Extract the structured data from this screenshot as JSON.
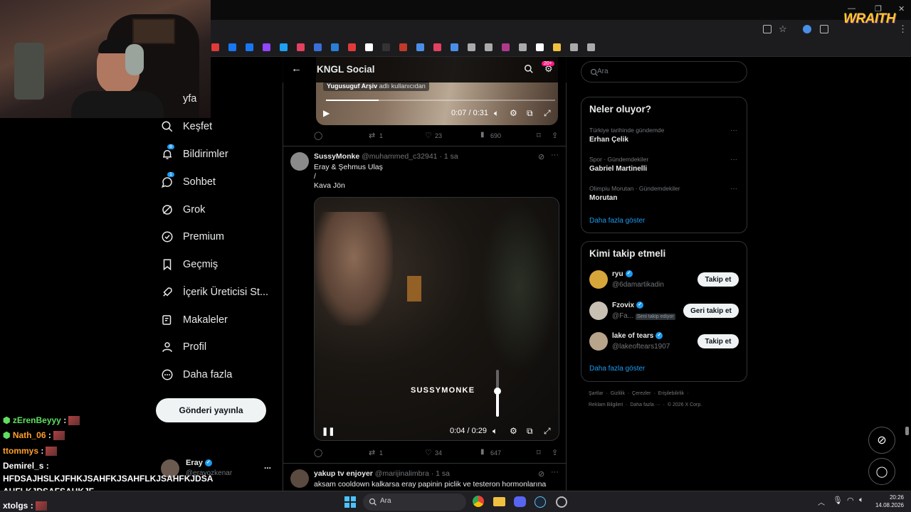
{
  "browser": {
    "overlay_logo": "WRAITH"
  },
  "nav": {
    "items": [
      {
        "label": "Anasayfa",
        "visible": "yfa"
      },
      {
        "label": "Keşfet"
      },
      {
        "label": "Bildirimler",
        "badge": "8"
      },
      {
        "label": "Sohbet",
        "badge": "1"
      },
      {
        "label": "Grok"
      },
      {
        "label": "Premium"
      },
      {
        "label": "Geçmiş"
      },
      {
        "label": "İçerik Üreticisi St..."
      },
      {
        "label": "Makaleler"
      },
      {
        "label": "Profil"
      },
      {
        "label": "Daha fazla"
      }
    ],
    "post_button": "Gönderi yayınla",
    "account": {
      "name": "Eray",
      "handle": "@erayozkenar",
      "more": "..."
    }
  },
  "header": {
    "title": "KNGL Social",
    "notif_badge": "20+"
  },
  "tweet1": {
    "attribution_user": "Yugusuguf Arşiv",
    "attribution_suffix": "adlı kullanıcıdan",
    "video_time": "0:07 / 0:31",
    "video_progress": 0.23,
    "replies": "",
    "retweets": "1",
    "likes": "23",
    "views": "690"
  },
  "tweet2": {
    "name": "SussyMonke",
    "handle": "@muhammed_c32941",
    "time": "· 1 sa",
    "line1": "Eray & Şehmus Ulaş",
    "line2": "/",
    "line3": "Kava Jön",
    "video_watermark": "SUSSYMONKE",
    "video_time": "0:04 / 0:29",
    "volume_level": 0.55,
    "retweets": "1",
    "likes": "34",
    "views": "647"
  },
  "tweet3": {
    "name": "yakup tv enjoyer",
    "handle": "@marijinalimbra",
    "time": "· 1 sa",
    "text": "aksam cooldown kalkarsa eray papinin piclik ve testeron hormonlarına"
  },
  "search": {
    "placeholder": "Ara"
  },
  "trends": {
    "title": "Neler oluyor?",
    "items": [
      {
        "context": "Türkiye tarihinde gündemde",
        "name": "Erhan Çelik"
      },
      {
        "context": "Spor · Gündemdekiler",
        "name": "Gabriel Martinelli"
      },
      {
        "context": "Olimpiu Morutan · Gündemdekiler",
        "name": "Morutan"
      }
    ],
    "more": "Daha fazla göster"
  },
  "who_to_follow": {
    "title": "Kimi takip etmeli",
    "items": [
      {
        "name": "ryu",
        "handle": "@6damartikadin",
        "button": "Takip et"
      },
      {
        "name": "Fzovix",
        "handle": "@Fa...",
        "tag": "Seni takip ediyor",
        "button": "Geri takip et"
      },
      {
        "name": "lake of tears",
        "handle": "@lakeoftears1907",
        "button": "Takip et"
      }
    ],
    "more": "Daha fazla göster"
  },
  "footer": {
    "row1": "Şartlar  ·  Gizlilik  ·  Çerezler  ·  Erişilebilirlik  ·",
    "row2": "Reklam Bilgileri  ·  Daha fazla ···  ·  © 2026 X Corp."
  },
  "chat": [
    {
      "user": "zErenBeyyy",
      "msg": ":",
      "color": "#5fe05f"
    },
    {
      "user": "Nath_06",
      "msg": ":",
      "color": "#ff9f2a"
    },
    {
      "user": "ttommys",
      "msg": ":",
      "color": "#ff9f2a"
    },
    {
      "user": "Demirel_s",
      "msg": ":",
      "color": "#ffffff"
    },
    {
      "user": "",
      "msg": "HFDSAJHSLKJFHKJSAHFKJSAHFLKJSAHFKJDSA",
      "color": "#ffffff"
    },
    {
      "user": "",
      "msg": "AHFLKJDSAFSAHKJF",
      "color": "#ffffff"
    },
    {
      "user": "xtolgs",
      "msg": ":",
      "color": "#ffffff"
    }
  ],
  "taskbar": {
    "search_placeholder": "Ara",
    "time": "20:26",
    "date": "14.08.2026"
  },
  "colors": {
    "accent": "#1d9bf0",
    "background": "#000000",
    "border": "#2f3336"
  }
}
